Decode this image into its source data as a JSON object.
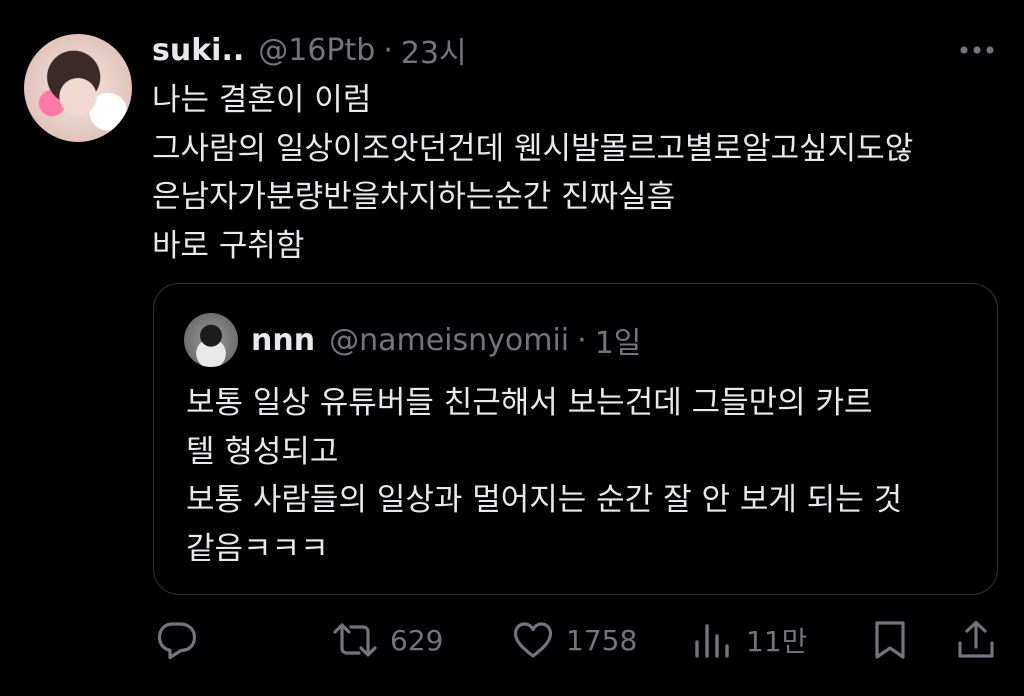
{
  "author": {
    "display_name": "suki..",
    "handle": "@16Ptb",
    "separator": "·",
    "time": "23시"
  },
  "tweet_text": [
    "나는 결혼이 이럼",
    "그사람의 일상이조앗던건데 웬시발몰르고별로알고싶지도않",
    "은남자가분량반을차지하는순간 진짜실흠",
    "바로 구취함"
  ],
  "quoted": {
    "display_name": "nnn",
    "handle": "@nameisnyomii",
    "separator": "·",
    "time": "1일",
    "text": [
      "보통 일상 유튜버들 친근해서 보는건데 그들만의 카르",
      "텔 형성되고",
      "보통 사람들의 일상과 멀어지는 순간 잘 안 보게 되는 것",
      "같음ㅋㅋㅋ"
    ]
  },
  "actions": {
    "reply": {
      "icon": "reply-icon"
    },
    "retweet": {
      "icon": "retweet-icon",
      "count": "629"
    },
    "like": {
      "icon": "heart-icon",
      "count": "1758"
    },
    "views": {
      "icon": "views-icon",
      "count": "11만"
    },
    "bookmark": {
      "icon": "bookmark-icon"
    },
    "share": {
      "icon": "share-icon"
    }
  },
  "colors": {
    "background": "#000000",
    "primary_text": "#e7e9ea",
    "secondary_text": "#71767b",
    "border": "#2f3336"
  }
}
